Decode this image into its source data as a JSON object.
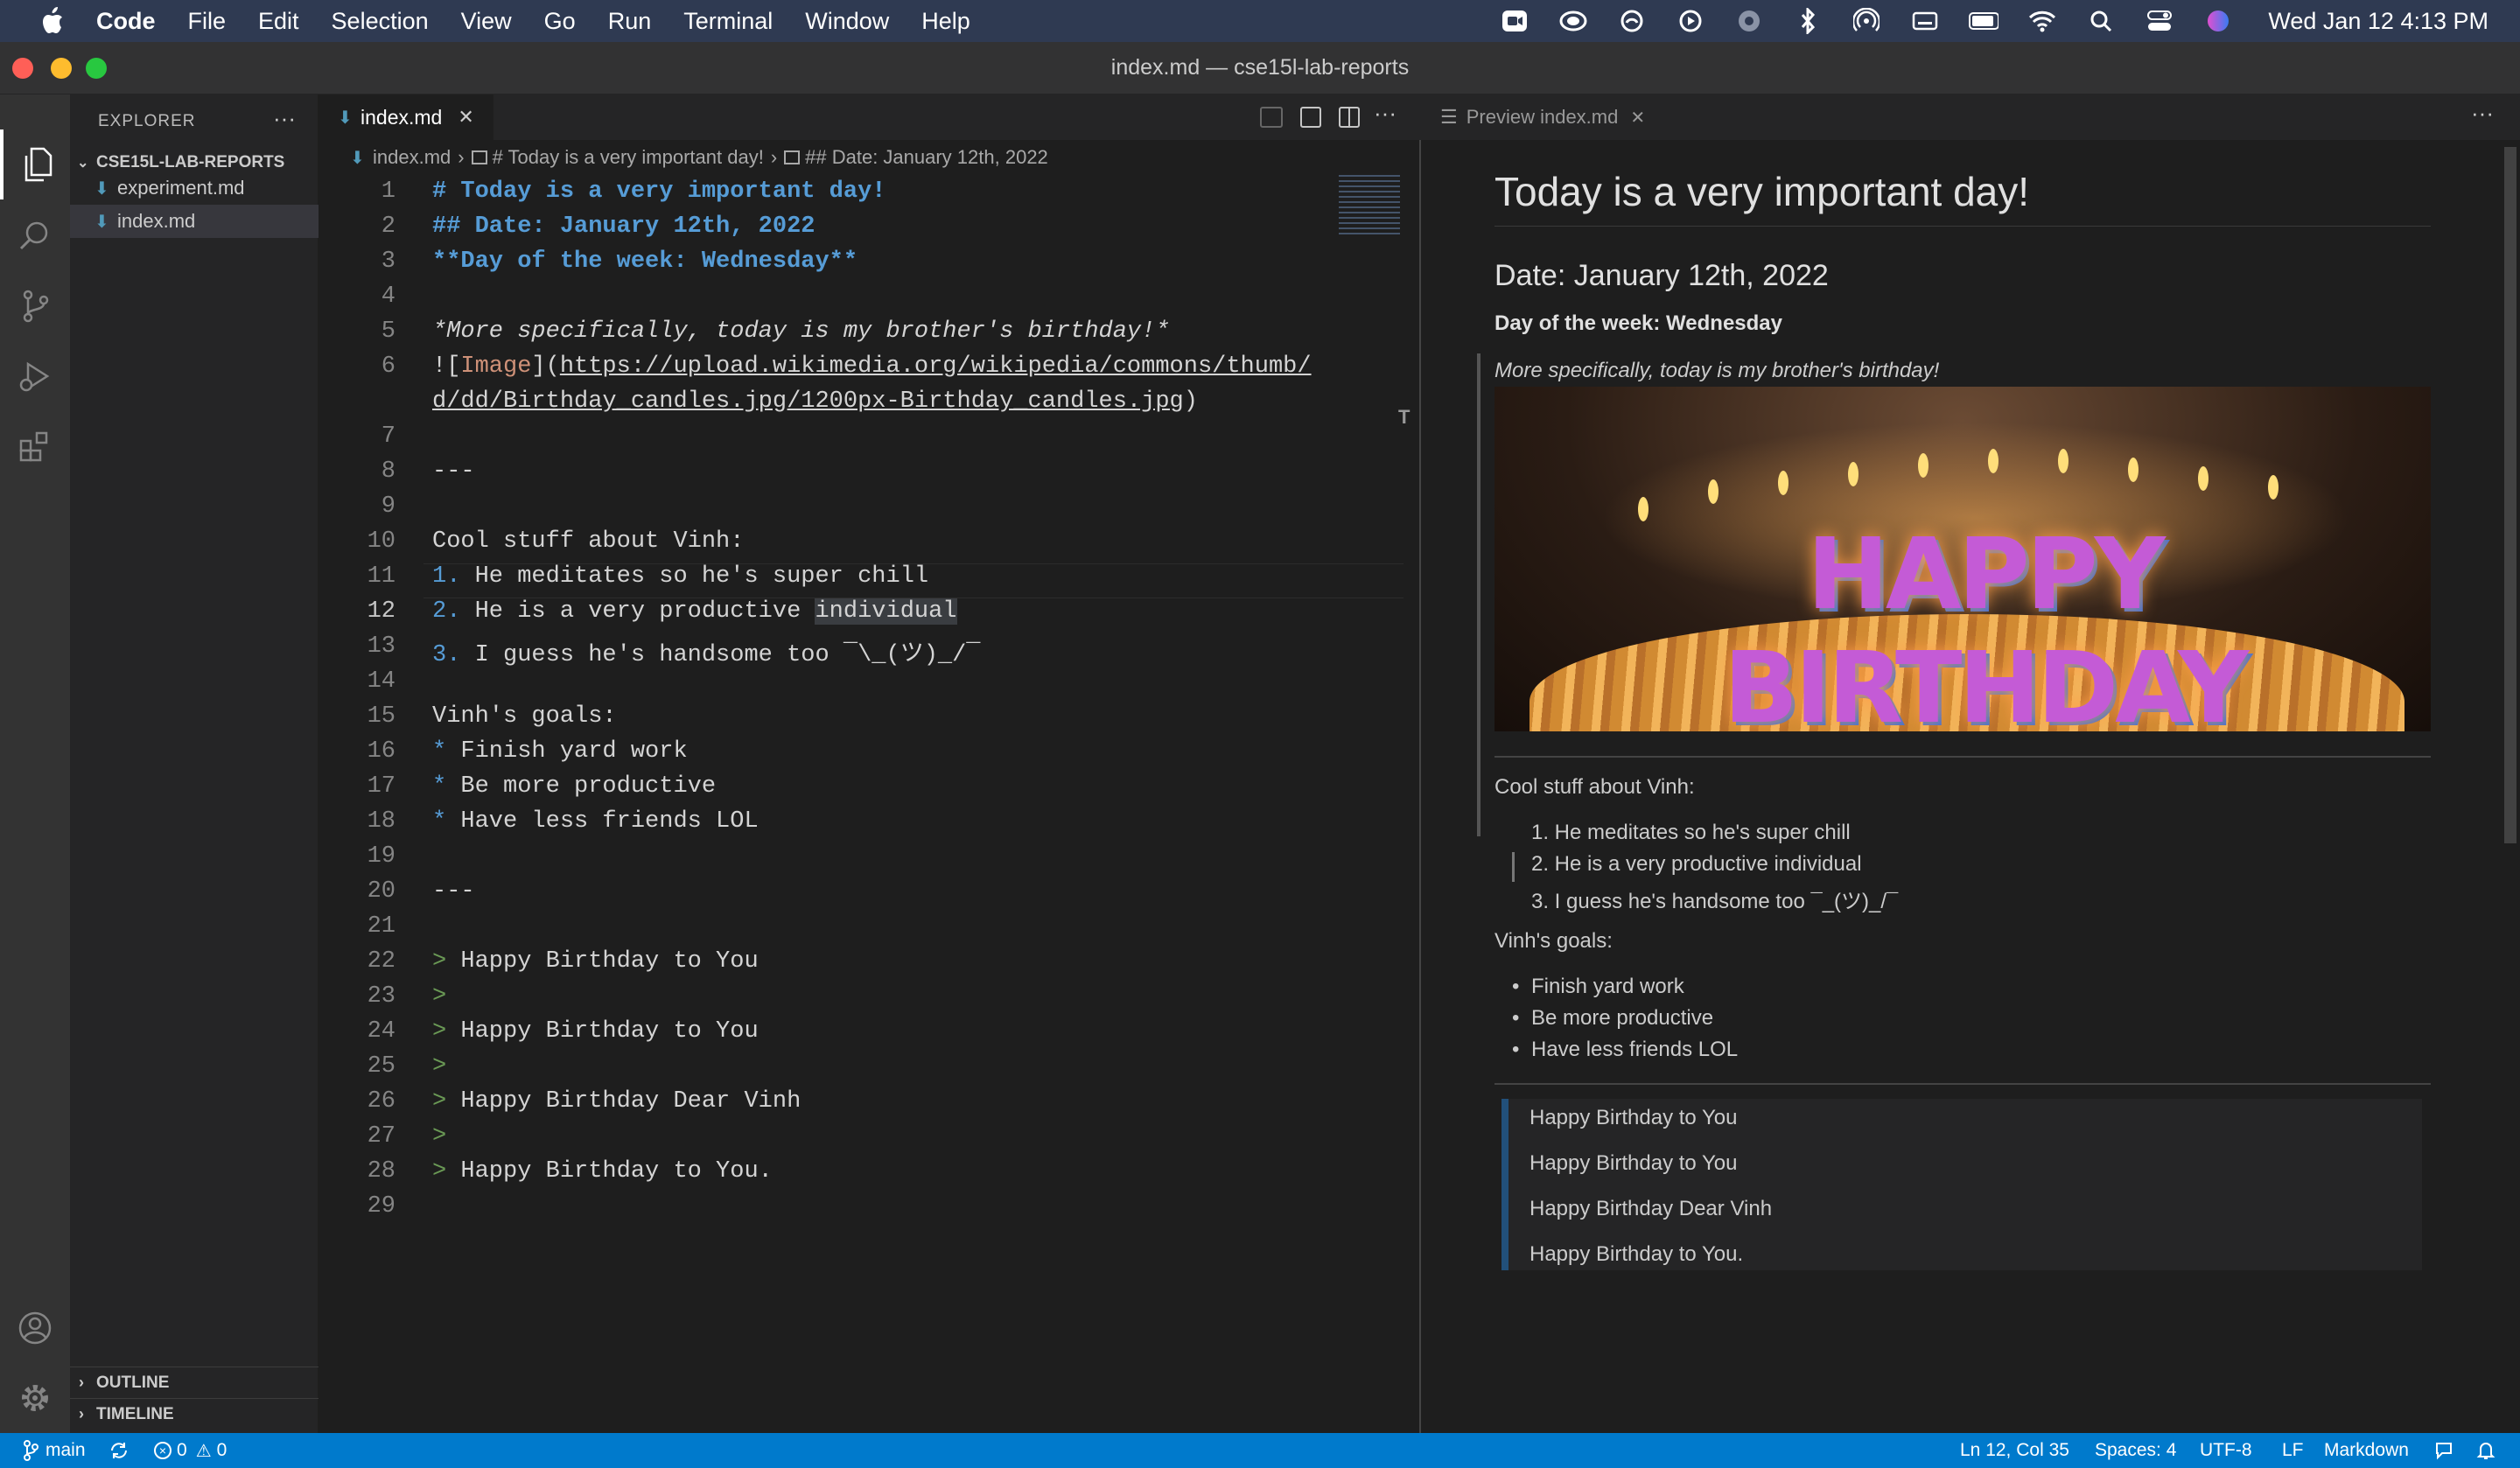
{
  "menubar": {
    "items": [
      "Code",
      "File",
      "Edit",
      "Selection",
      "View",
      "Go",
      "Run",
      "Terminal",
      "Window",
      "Help"
    ],
    "clock": "Wed Jan 12  4:13 PM"
  },
  "window": {
    "title": "index.md — cse15l-lab-reports"
  },
  "sidebar": {
    "header": "EXPLORER",
    "folder": "CSE15L-LAB-REPORTS",
    "files": [
      "experiment.md",
      "index.md"
    ],
    "sections": [
      "OUTLINE",
      "TIMELINE"
    ]
  },
  "editor": {
    "tab": "index.md",
    "breadcrumb": [
      "index.md",
      "# Today is a very important day!",
      "## Date: January 12th, 2022"
    ],
    "line_numbers": [
      "1",
      "2",
      "3",
      "4",
      "5",
      "6",
      "",
      "7",
      "8",
      "9",
      "10",
      "11",
      "12",
      "13",
      "14",
      "15",
      "16",
      "17",
      "18",
      "19",
      "20",
      "21",
      "22",
      "23",
      "24",
      "25",
      "26",
      "27",
      "28",
      "29"
    ],
    "lines": {
      "l1": "# Today is a very important day!",
      "l2": "## Date: January 12th, 2022",
      "l3": "**Day of the week: Wednesday**",
      "l5": "*More specifically, today is my brother's birthday!*",
      "l6a_bang": "![",
      "l6a_alt": "Image",
      "l6a_mid": "](",
      "l6a_url": "https://upload.wikimedia.org/wikipedia/commons/thumb/",
      "l6b_url": "d/dd/Birthday_candles.jpg/1200px-Birthday_candles.jpg",
      "l6b_end": ")",
      "l8": "---",
      "l10": "Cool stuff about Vinh:",
      "l11_num": "1.",
      "l11": " He meditates so he's super chill",
      "l12_num": "2.",
      "l12_pre": " He is a very productive ",
      "l12_word": "individual",
      "l13_num": "3.",
      "l13": " I guess he's handsome too ¯\\_(ツ)_/¯",
      "l15": "Vinh's goals:",
      "l16_bullet": "*",
      "l16": " Finish yard work",
      "l17_bullet": "*",
      "l17": " Be more productive",
      "l18_bullet": "*",
      "l18": " Have less friends LOL",
      "l20": "---",
      "gt": ">",
      "l22": " Happy Birthday to You",
      "l24": " Happy Birthday to You",
      "l26": " Happy Birthday Dear Vinh",
      "l28": " Happy Birthday to You."
    }
  },
  "preview": {
    "tab": "Preview index.md",
    "h1": "Today is a very important day!",
    "h2": "Date: January 12th, 2022",
    "bold": "Day of the week: Wednesday",
    "italic": "More specifically, today is my brother's birthday!",
    "image_text": "HAPPY BIRTHDAY",
    "cool": "Cool stuff about Vinh:",
    "ol": [
      "1. He meditates so he's super chill",
      "2. He is a very productive individual",
      "3. I guess he's handsome too ¯_(ツ)_/¯"
    ],
    "goals": "Vinh's goals:",
    "ul": [
      "Finish yard work",
      "Be more productive",
      "Have less friends LOL"
    ],
    "quote": [
      "Happy Birthday to You",
      "Happy Birthday to You",
      "Happy Birthday Dear Vinh",
      "Happy Birthday to You."
    ]
  },
  "statusbar": {
    "branch": "main",
    "errors": "0",
    "warnings": "0",
    "position": "Ln 12, Col 35",
    "spaces": "Spaces: 4",
    "encoding": "UTF-8",
    "eol": "LF",
    "language": "Markdown"
  },
  "colors": {
    "accent": "#007acc",
    "heading": "#569cd6",
    "blockquote": "#6a9955",
    "link": "#ce9178"
  }
}
